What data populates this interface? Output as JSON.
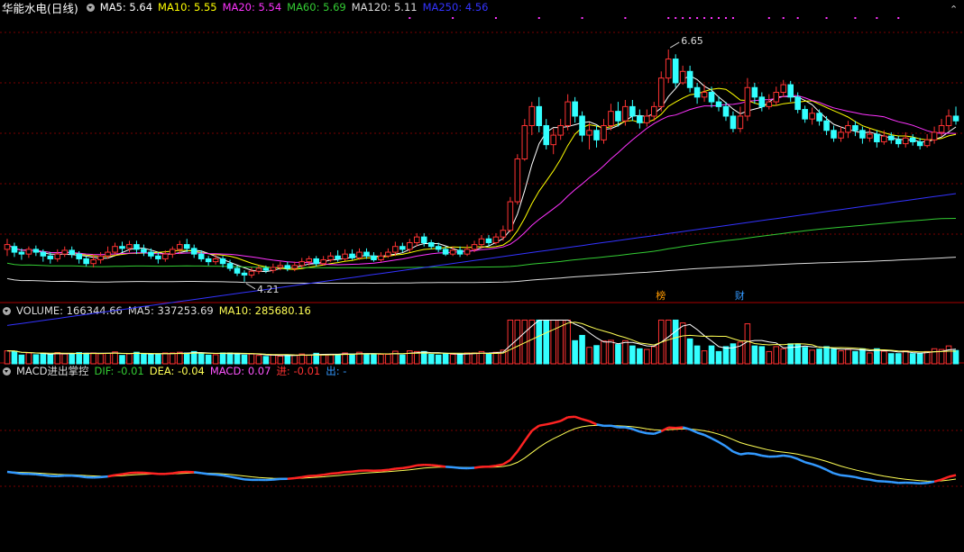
{
  "header": {
    "stock_name": "华能水电(日线)",
    "ma_labels": [
      {
        "text": "MA5: 5.64",
        "color": "#ffffff"
      },
      {
        "text": "MA10: 5.55",
        "color": "#ffff00"
      },
      {
        "text": "MA20: 5.54",
        "color": "#ff33ff"
      },
      {
        "text": "MA60: 5.69",
        "color": "#33cc33"
      },
      {
        "text": "MA120: 5.11",
        "color": "#dddddd"
      },
      {
        "text": "MA250: 4.56",
        "color": "#3333ff"
      }
    ]
  },
  "volume_header": {
    "items": [
      {
        "text": "VOLUME: 166344.66",
        "color": "#dddddd"
      },
      {
        "text": "MA5: 337253.69",
        "color": "#dddddd"
      },
      {
        "text": "MA10: 285680.16",
        "color": "#ffff55"
      }
    ]
  },
  "macd_header": {
    "items": [
      {
        "text": "MACD进出掌控",
        "color": "#dddddd"
      },
      {
        "text": "DIF: -0.01",
        "color": "#33cc33"
      },
      {
        "text": "DEA: -0.04",
        "color": "#ffff55"
      },
      {
        "text": "MACD: 0.07",
        "color": "#ff55ff"
      },
      {
        "text": "进: -0.01",
        "color": "#ff3333"
      },
      {
        "text": "出: -",
        "color": "#3399ff"
      }
    ]
  },
  "annotations": {
    "high_label": "6.65",
    "low_label": "4.21",
    "marker_bang": "榜",
    "marker_cai": "财"
  },
  "colors": {
    "up": "#ff3333",
    "down": "#33ffff",
    "grid": "#7a0000",
    "ma5": "#ffffff",
    "ma10": "#ffff00",
    "ma20": "#ff33ff",
    "ma60": "#33cc33",
    "ma120": "#dddddd",
    "ma250": "#3333ff",
    "dot": "#ff33ff"
  },
  "chart_data": {
    "type": "candlestick",
    "price_range": [
      4.0,
      7.0
    ],
    "high": 6.65,
    "low": 4.21,
    "candles": [
      [
        4.55,
        4.6,
        4.66,
        4.48
      ],
      [
        4.58,
        4.52,
        4.62,
        4.47
      ],
      [
        4.52,
        4.5,
        4.56,
        4.44
      ],
      [
        4.5,
        4.55,
        4.58,
        4.46
      ],
      [
        4.55,
        4.52,
        4.59,
        4.48
      ],
      [
        4.52,
        4.48,
        4.55,
        4.42
      ],
      [
        4.48,
        4.45,
        4.52,
        4.4
      ],
      [
        4.45,
        4.5,
        4.55,
        4.42
      ],
      [
        4.5,
        4.54,
        4.58,
        4.47
      ],
      [
        4.54,
        4.5,
        4.58,
        4.46
      ],
      [
        4.5,
        4.45,
        4.53,
        4.4
      ],
      [
        4.45,
        4.4,
        4.48,
        4.37
      ],
      [
        4.4,
        4.44,
        4.5,
        4.36
      ],
      [
        4.44,
        4.48,
        4.52,
        4.4
      ],
      [
        4.48,
        4.52,
        4.58,
        4.45
      ],
      [
        4.52,
        4.58,
        4.62,
        4.49
      ],
      [
        4.58,
        4.56,
        4.63,
        4.52
      ],
      [
        4.56,
        4.6,
        4.64,
        4.52
      ],
      [
        4.6,
        4.55,
        4.64,
        4.5
      ],
      [
        4.55,
        4.52,
        4.6,
        4.48
      ],
      [
        4.52,
        4.48,
        4.56,
        4.45
      ],
      [
        4.48,
        4.45,
        4.52,
        4.4
      ],
      [
        4.45,
        4.5,
        4.54,
        4.42
      ],
      [
        4.5,
        4.55,
        4.58,
        4.46
      ],
      [
        4.55,
        4.6,
        4.64,
        4.5
      ],
      [
        4.6,
        4.56,
        4.66,
        4.52
      ],
      [
        4.56,
        4.5,
        4.6,
        4.46
      ],
      [
        4.5,
        4.45,
        4.54,
        4.42
      ],
      [
        4.45,
        4.42,
        4.48,
        4.38
      ],
      [
        4.42,
        4.45,
        4.5,
        4.39
      ],
      [
        4.45,
        4.4,
        4.48,
        4.36
      ],
      [
        4.4,
        4.35,
        4.44,
        4.32
      ],
      [
        4.35,
        4.3,
        4.38,
        4.27
      ],
      [
        4.3,
        4.28,
        4.33,
        4.21
      ],
      [
        4.28,
        4.32,
        4.36,
        4.25
      ],
      [
        4.32,
        4.35,
        4.38,
        4.29
      ],
      [
        4.35,
        4.33,
        4.38,
        4.3
      ],
      [
        4.33,
        4.36,
        4.4,
        4.3
      ],
      [
        4.36,
        4.38,
        4.42,
        4.33
      ],
      [
        4.38,
        4.35,
        4.42,
        4.32
      ],
      [
        4.35,
        4.38,
        4.42,
        4.32
      ],
      [
        4.38,
        4.42,
        4.46,
        4.35
      ],
      [
        4.42,
        4.45,
        4.48,
        4.38
      ],
      [
        4.45,
        4.4,
        4.48,
        4.37
      ],
      [
        4.4,
        4.44,
        4.48,
        4.38
      ],
      [
        4.44,
        4.48,
        4.52,
        4.42
      ],
      [
        4.48,
        4.45,
        4.54,
        4.42
      ],
      [
        4.45,
        4.5,
        4.55,
        4.43
      ],
      [
        4.5,
        4.46,
        4.55,
        4.44
      ],
      [
        4.46,
        4.52,
        4.56,
        4.44
      ],
      [
        4.52,
        4.48,
        4.56,
        4.45
      ],
      [
        4.48,
        4.44,
        4.52,
        4.42
      ],
      [
        4.44,
        4.48,
        4.52,
        4.42
      ],
      [
        4.48,
        4.52,
        4.56,
        4.46
      ],
      [
        4.52,
        4.58,
        4.63,
        4.48
      ],
      [
        4.58,
        4.55,
        4.62,
        4.52
      ],
      [
        4.55,
        4.62,
        4.66,
        4.52
      ],
      [
        4.62,
        4.68,
        4.72,
        4.58
      ],
      [
        4.68,
        4.62,
        4.72,
        4.58
      ],
      [
        4.62,
        4.58,
        4.65,
        4.55
      ],
      [
        4.58,
        4.55,
        4.62,
        4.52
      ],
      [
        4.55,
        4.5,
        4.58,
        4.48
      ],
      [
        4.5,
        4.54,
        4.58,
        4.48
      ],
      [
        4.54,
        4.5,
        4.58,
        4.47
      ],
      [
        4.5,
        4.55,
        4.6,
        4.48
      ],
      [
        4.55,
        4.6,
        4.64,
        4.52
      ],
      [
        4.6,
        4.66,
        4.7,
        4.56
      ],
      [
        4.66,
        4.62,
        4.7,
        4.58
      ],
      [
        4.62,
        4.68,
        4.72,
        4.6
      ],
      [
        4.68,
        4.75,
        4.8,
        4.64
      ],
      [
        4.75,
        5.05,
        5.1,
        4.73
      ],
      [
        5.05,
        5.5,
        5.55,
        5.02
      ],
      [
        5.5,
        5.85,
        5.92,
        5.48
      ],
      [
        5.85,
        6.05,
        6.1,
        5.75
      ],
      [
        6.05,
        5.85,
        6.15,
        5.78
      ],
      [
        5.85,
        5.65,
        5.92,
        5.6
      ],
      [
        5.65,
        5.75,
        5.82,
        5.55
      ],
      [
        5.75,
        5.85,
        5.92,
        5.7
      ],
      [
        5.85,
        6.1,
        6.18,
        5.8
      ],
      [
        6.1,
        5.95,
        6.15,
        5.88
      ],
      [
        5.95,
        5.75,
        6.0,
        5.68
      ],
      [
        5.75,
        5.8,
        5.88,
        5.6
      ],
      [
        5.8,
        5.7,
        5.85,
        5.62
      ],
      [
        5.7,
        5.85,
        5.92,
        5.66
      ],
      [
        5.85,
        6.0,
        6.08,
        5.8
      ],
      [
        6.0,
        5.9,
        6.1,
        5.84
      ],
      [
        5.9,
        6.05,
        6.12,
        5.85
      ],
      [
        6.05,
        5.95,
        6.12,
        5.9
      ],
      [
        5.95,
        5.88,
        6.02,
        5.82
      ],
      [
        5.88,
        5.95,
        6.02,
        5.84
      ],
      [
        5.95,
        6.05,
        6.1,
        5.9
      ],
      [
        6.05,
        6.35,
        6.42,
        6.0
      ],
      [
        6.35,
        6.55,
        6.65,
        6.3
      ],
      [
        6.55,
        6.3,
        6.6,
        6.25
      ],
      [
        6.3,
        6.42,
        6.48,
        6.28
      ],
      [
        6.42,
        6.25,
        6.48,
        6.2
      ],
      [
        6.25,
        6.15,
        6.3,
        6.08
      ],
      [
        6.15,
        6.2,
        6.28,
        6.1
      ],
      [
        6.2,
        6.1,
        6.26,
        6.04
      ],
      [
        6.1,
        6.05,
        6.16,
        6.0
      ],
      [
        6.05,
        5.95,
        6.1,
        5.9
      ],
      [
        5.95,
        5.82,
        6.0,
        5.78
      ],
      [
        5.82,
        5.95,
        6.05,
        5.78
      ],
      [
        5.95,
        6.25,
        6.35,
        5.9
      ],
      [
        6.25,
        6.15,
        6.3,
        6.08
      ],
      [
        6.15,
        6.05,
        6.2,
        6.0
      ],
      [
        6.05,
        6.1,
        6.18,
        6.02
      ],
      [
        6.1,
        6.2,
        6.26,
        6.06
      ],
      [
        6.2,
        6.28,
        6.33,
        6.15
      ],
      [
        6.28,
        6.15,
        6.32,
        6.1
      ],
      [
        6.15,
        6.02,
        6.2,
        5.98
      ],
      [
        6.02,
        5.92,
        6.06,
        5.88
      ],
      [
        5.92,
        5.98,
        6.04,
        5.86
      ],
      [
        5.98,
        5.9,
        6.02,
        5.85
      ],
      [
        5.9,
        5.8,
        5.95,
        5.75
      ],
      [
        5.8,
        5.72,
        5.85,
        5.68
      ],
      [
        5.72,
        5.78,
        5.84,
        5.68
      ],
      [
        5.78,
        5.85,
        5.9,
        5.72
      ],
      [
        5.85,
        5.8,
        5.9,
        5.74
      ],
      [
        5.8,
        5.72,
        5.84,
        5.66
      ],
      [
        5.72,
        5.76,
        5.82,
        5.68
      ],
      [
        5.76,
        5.68,
        5.8,
        5.62
      ],
      [
        5.68,
        5.74,
        5.8,
        5.65
      ],
      [
        5.74,
        5.7,
        5.78,
        5.66
      ],
      [
        5.7,
        5.66,
        5.74,
        5.62
      ],
      [
        5.66,
        5.72,
        5.78,
        5.62
      ],
      [
        5.72,
        5.68,
        5.76,
        5.64
      ],
      [
        5.68,
        5.64,
        5.72,
        5.6
      ],
      [
        5.64,
        5.7,
        5.76,
        5.62
      ],
      [
        5.7,
        5.78,
        5.84,
        5.66
      ],
      [
        5.78,
        5.85,
        5.92,
        5.74
      ],
      [
        5.85,
        5.95,
        6.02,
        5.8
      ],
      [
        5.95,
        5.9,
        6.05,
        5.86
      ]
    ],
    "volume_range": [
      0,
      600000
    ],
    "macd_range": [
      -0.55,
      0.65
    ]
  }
}
